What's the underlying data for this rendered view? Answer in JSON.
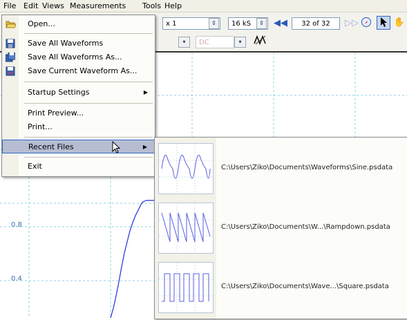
{
  "menubar": {
    "items": [
      "File",
      "Edit",
      "Views",
      "Measurements",
      "Tools",
      "Help"
    ]
  },
  "toolbar": {
    "zoom_value": "x 1",
    "samples_value": "16 kS",
    "waveform_counter": "32 of 32",
    "coupling_value": "DC"
  },
  "plot": {
    "y_labels": [
      "0.8",
      "0.4"
    ]
  },
  "file_menu": {
    "items": [
      {
        "label": "Open...",
        "icon": "open-folder-icon"
      },
      {
        "label": "Save All Waveforms",
        "icon": "save-disk-icon"
      },
      {
        "label": "Save All Waveforms As...",
        "icon": "save-as-disk-icon"
      },
      {
        "label": "Save Current Waveform As...",
        "icon": "save-current-disk-icon"
      },
      {
        "label": "Startup Settings"
      },
      {
        "label": "Print Preview..."
      },
      {
        "label": "Print..."
      },
      {
        "label": "Recent Files"
      },
      {
        "label": "Exit"
      }
    ]
  },
  "recent_files": [
    {
      "path": "C:\\Users\\Ziko\\Documents\\Waveforms\\Sine.psdata",
      "wave": "sine"
    },
    {
      "path": "C:\\Users\\Ziko\\Documents\\W...\\Rampdown.psdata",
      "wave": "rampdown"
    },
    {
      "path": "C:\\Users\\Ziko\\Documents\\Wave...\\Square.psdata",
      "wave": "square"
    }
  ],
  "colors": {
    "accent": "#316ac5",
    "waveform": "#1f2fd8",
    "highlight": "#b6bdd2"
  }
}
